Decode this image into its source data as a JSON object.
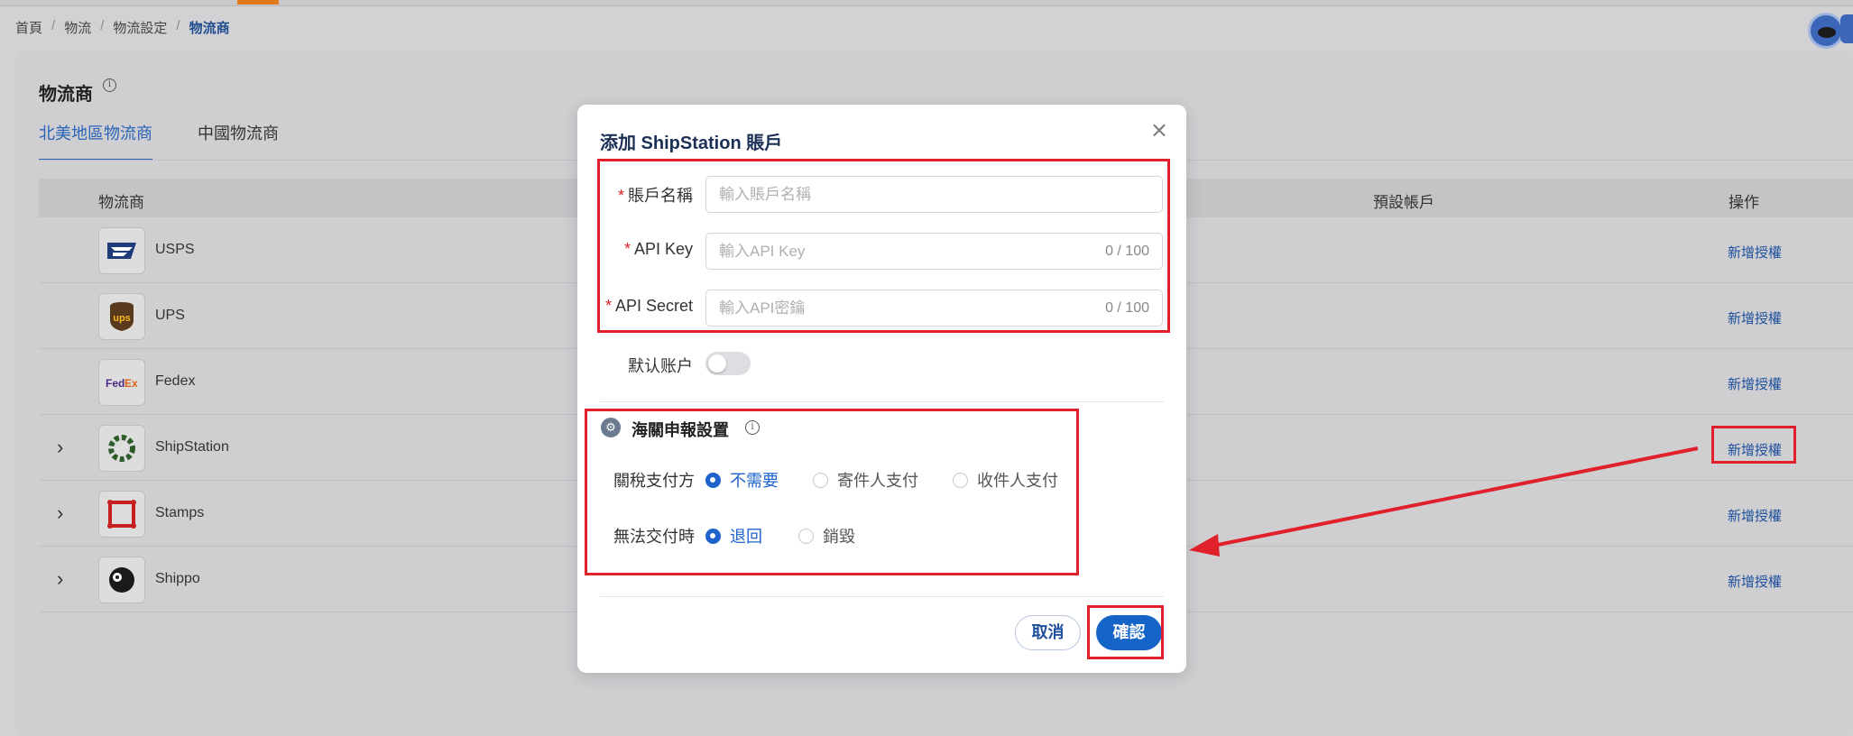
{
  "breadcrumb": [
    "首頁",
    "物流",
    "物流設定",
    "物流商"
  ],
  "page": {
    "title": "物流商"
  },
  "tabs": [
    {
      "label": "北美地區物流商"
    },
    {
      "label": "中國物流商"
    }
  ],
  "table": {
    "headers": {
      "carrier": "物流商",
      "default_account": "預設帳戶",
      "action": "操作"
    },
    "rows": [
      {
        "name": "USPS",
        "action": "新增授權",
        "expandable": false,
        "icon": "usps-logo-icon"
      },
      {
        "name": "UPS",
        "action": "新增授權",
        "expandable": false,
        "icon": "ups-logo-icon"
      },
      {
        "name": "Fedex",
        "action": "新增授權",
        "expandable": false,
        "icon": "fedex-logo-icon"
      },
      {
        "name": "ShipStation",
        "action": "新增授權",
        "expandable": true,
        "icon": "shipstation-logo-icon"
      },
      {
        "name": "Stamps",
        "action": "新增授權",
        "expandable": true,
        "icon": "stamps-logo-icon"
      },
      {
        "name": "Shippo",
        "action": "新增授權",
        "expandable": true,
        "icon": "shippo-logo-icon"
      }
    ]
  },
  "modal": {
    "title": "添加 ShipStation 賬戶",
    "fields": {
      "account_name": {
        "label": "賬戶名稱",
        "placeholder": "輸入賬戶名稱",
        "value": ""
      },
      "api_key": {
        "label": "API Key",
        "placeholder": "輸入API Key",
        "counter": "0 / 100",
        "value": ""
      },
      "api_secret": {
        "label": "API Secret",
        "placeholder": "輸入API密鑰",
        "counter": "0 / 100",
        "value": ""
      }
    },
    "default_account": {
      "label": "默认账户",
      "on": false
    },
    "customs": {
      "title": "海關申報設置",
      "duty_payer": {
        "label": "關稅支付方",
        "options": [
          "不需要",
          "寄件人支付",
          "收件人支付"
        ],
        "selected": "不需要"
      },
      "undeliverable": {
        "label": "無法交付時",
        "options": [
          "退回",
          "銷毀"
        ],
        "selected": "退回"
      }
    },
    "cancel_label": "取消",
    "confirm_label": "確認"
  },
  "colors": {
    "accent": "#1565c8",
    "annotation_red": "#e0202a",
    "link": "#1d4f9c"
  }
}
